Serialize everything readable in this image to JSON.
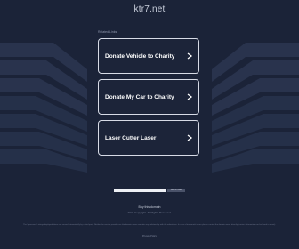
{
  "domain": "ktr7.net",
  "related_label": "Related Links",
  "links": [
    {
      "label": "Donate Vehicle to Charity"
    },
    {
      "label": "Donate My Car to Charity"
    },
    {
      "label": "Laser Cutter Laser"
    }
  ],
  "search": {
    "placeholder": "",
    "button_label": "Search Ads"
  },
  "buy_domain": "Buy this domain",
  "copyright": "2024 Copyright. All Rights Reserved.",
  "disclaimer": "The Sponsored Listings displayed above are served automatically by a third party. Neither the service provider nor the domain owner maintain any relationship with the advertisers. In case of trademark issues please contact the domain owner directly (contact information can be found in whois).",
  "privacy": "Privacy Policy",
  "colors": {
    "background": "#1b2338",
    "card_border": "#d7dbe6",
    "band_light": "#2b3550",
    "band_dark": "#232c44"
  },
  "icons": {
    "chevron": "chevron-right-icon"
  }
}
